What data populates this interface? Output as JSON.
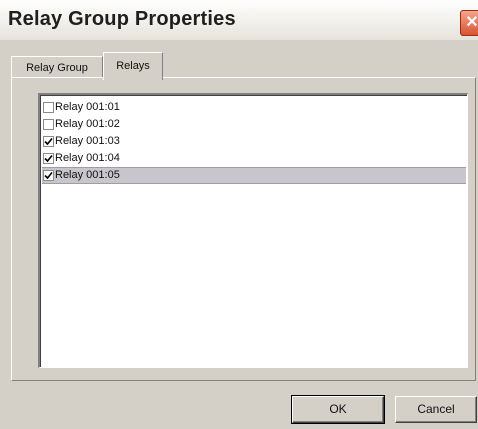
{
  "window": {
    "title": "Relay Group Properties",
    "close_glyph": "✕"
  },
  "tabs": [
    {
      "label": "Relay Group",
      "active": false
    },
    {
      "label": "Relays",
      "active": true
    }
  ],
  "relays": [
    {
      "label": "Relay 001:01",
      "checked": false,
      "selected": false
    },
    {
      "label": "Relay 001:02",
      "checked": false,
      "selected": false
    },
    {
      "label": "Relay 001:03",
      "checked": true,
      "selected": false
    },
    {
      "label": "Relay 001:04",
      "checked": true,
      "selected": false
    },
    {
      "label": "Relay 001:05",
      "checked": true,
      "selected": true
    }
  ],
  "buttons": {
    "ok_label": "OK",
    "cancel_label": "Cancel"
  },
  "colors": {
    "selection": "#c8c6cc",
    "close_button": "#d9532f",
    "dialog_face": "#d4d0c8"
  },
  "icons": {
    "close": "close-icon",
    "checkmark": "checkmark-icon"
  }
}
